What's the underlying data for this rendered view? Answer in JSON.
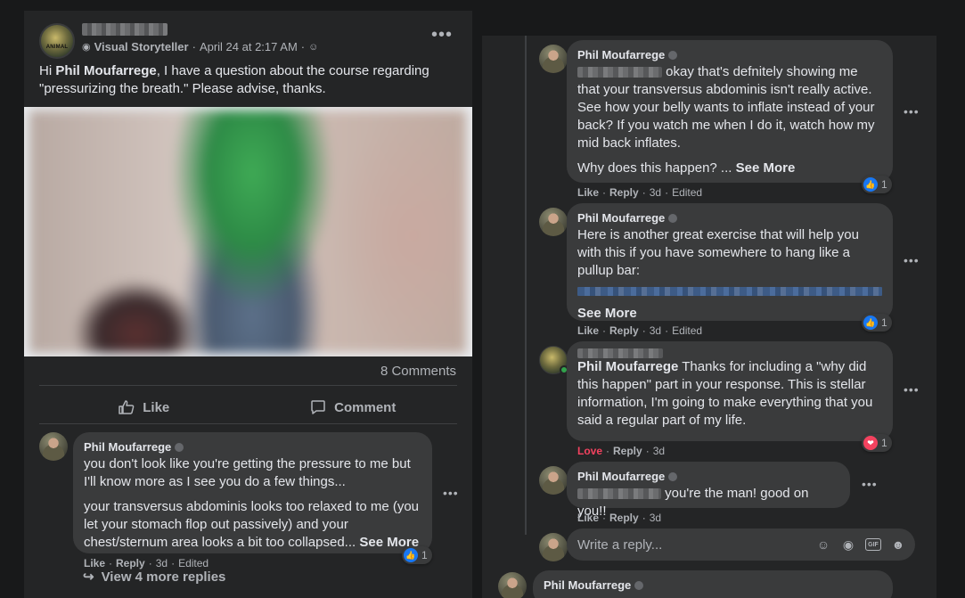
{
  "post": {
    "role_label": "Visual Storyteller",
    "timestamp": "April 24 at 2:17 AM",
    "separator": "·",
    "text_prefix": "Hi ",
    "mention": "Phil Moufarrege",
    "text_suffix": ", I have a question about the course regarding \"pressurizing the breath.\" Please advise, thanks.",
    "avatar_text": "ANIMAL",
    "comments_count": "8 Comments",
    "like_label": "Like",
    "comment_label": "Comment"
  },
  "left_comment": {
    "author": "Phil Moufarrege",
    "paragraph1": "you don't look like you're getting the pressure to me but I'll know more as I see you do a few things...",
    "paragraph2": "your transversus abdominis looks too relaxed to me (you let your stomach flop out passively) and your chest/sternum area looks a bit too collapsed...",
    "see_more": "See More",
    "actions": {
      "like": "Like",
      "reply": "Reply",
      "time": "3d",
      "edited": "Edited"
    },
    "reaction_count": "1",
    "view_more": "View 4 more replies"
  },
  "right_comments": [
    {
      "author": "Phil Moufarrege",
      "text": " okay that's defnitely showing me that your transversus abdominis isn't really active. See how your belly wants to inflate instead of your back? If you watch me when I do it, watch how my mid back inflates.",
      "text2": "Why does this happen? ...",
      "see_more": "See More",
      "actions": {
        "like": "Like",
        "reply": "Reply",
        "time": "3d",
        "edited": "Edited"
      },
      "reaction_count": "1"
    },
    {
      "author": "Phil Moufarrege",
      "text": "Here is another great exercise that will help you with this if you have somewhere to hang like a pullup bar:",
      "see_more": "See More",
      "actions": {
        "like": "Like",
        "reply": "Reply",
        "time": "3d",
        "edited": "Edited"
      },
      "reaction_count": "1"
    },
    {
      "mention": "Phil Moufarrege",
      "text": " Thanks for including a \"why did this happen\" part in your response. This is stellar information, I'm going to make everything that you said a regular part of my life.",
      "actions": {
        "like": "Love",
        "reply": "Reply",
        "time": "3d"
      },
      "reaction_count": "1"
    },
    {
      "author": "Phil Moufarrege",
      "text": " you're the man! good on you!!",
      "actions": {
        "like": "Like",
        "reply": "Reply",
        "time": "3d"
      }
    }
  ],
  "reply_box": {
    "placeholder": "Write a reply..."
  },
  "bottom_author": "Phil Moufarrege",
  "colors": {
    "background": "#18191a",
    "card": "#242526",
    "bubble": "#3a3b3c",
    "like_blue": "#1877f2",
    "love_red": "#f3425f"
  }
}
